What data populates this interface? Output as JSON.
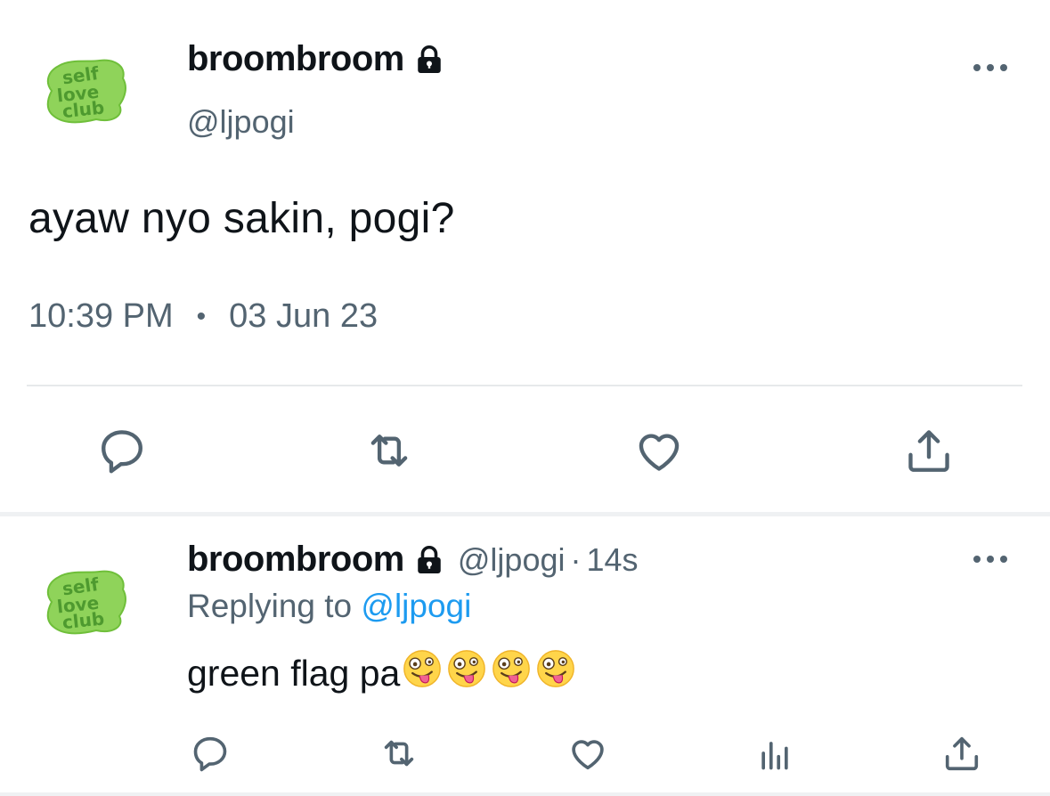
{
  "main_tweet": {
    "display_name": "broombroom",
    "handle": "@ljpogi",
    "text": "ayaw nyo sakin, pogi?",
    "time": "10:39 PM",
    "separator": "•",
    "date": "03 Jun 23",
    "avatar_logo_text": "self love club",
    "icons": {
      "lock": "lock-icon",
      "more": "more-options-icon",
      "reply": "reply-icon",
      "retweet": "retweet-icon",
      "like": "heart-icon",
      "share": "share-icon"
    }
  },
  "reply_tweet": {
    "display_name": "broombroom",
    "handle": "@ljpogi",
    "separator": "·",
    "time_ago": "14s",
    "replying_prefix": "Replying to",
    "replying_to": "@ljpogi",
    "text": "green flag pa",
    "emoji_count": 4,
    "emoji_name": "zany-face-emoji",
    "icons": {
      "lock": "lock-icon",
      "more": "more-options-icon",
      "reply": "reply-icon",
      "retweet": "retweet-icon",
      "like": "heart-icon",
      "views": "views-chart-icon",
      "share": "share-icon"
    }
  },
  "colors": {
    "text_primary": "#0f1419",
    "text_secondary": "#536471",
    "link": "#1d9bf0",
    "divider": "#e6e9eb",
    "avatar_green": "#8fd35a",
    "avatar_text_green": "#4e9a2f"
  }
}
